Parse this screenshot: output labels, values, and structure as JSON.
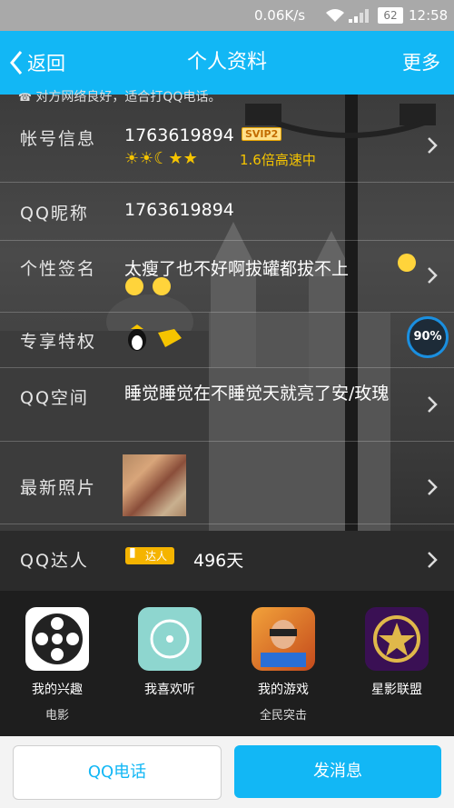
{
  "status_bar": {
    "speed": "0.06K/s",
    "battery": "62",
    "time": "12:58"
  },
  "nav": {
    "back_label": "返回",
    "title": "个人资料",
    "more_label": "更多"
  },
  "notice": "对方网络良好，适合打QQ电话。",
  "account": {
    "label": "帐号信息",
    "number": "1763619894",
    "vip_badge": "SVIP2",
    "speed_text": "1.6倍高速中"
  },
  "nickname": {
    "label": "QQ昵称",
    "value": "1763619894"
  },
  "signature": {
    "label": "个性签名",
    "value": "太瘦了也不好啊拔罐都拔不上"
  },
  "privileges": {
    "label": "专享特权",
    "progress": "90%"
  },
  "qzone": {
    "label": "QQ空间",
    "value": "睡觉睡觉在不睡觉天就亮了安/玫瑰"
  },
  "photos": {
    "label": "最新照片"
  },
  "expert": {
    "label": "QQ达人",
    "badge_text": "达人",
    "days": "496天"
  },
  "apps": [
    {
      "name": "我的兴趣",
      "sub": "电影"
    },
    {
      "name": "我喜欢听",
      "sub": ""
    },
    {
      "name": "我的游戏",
      "sub": "全民突击"
    },
    {
      "name": "星影联盟",
      "sub": ""
    }
  ],
  "buttons": {
    "call": "QQ电话",
    "message": "发消息"
  },
  "colors": {
    "accent": "#12b7f5",
    "vip_yellow": "#f5c400",
    "status_bar": "#a9a9a9"
  }
}
